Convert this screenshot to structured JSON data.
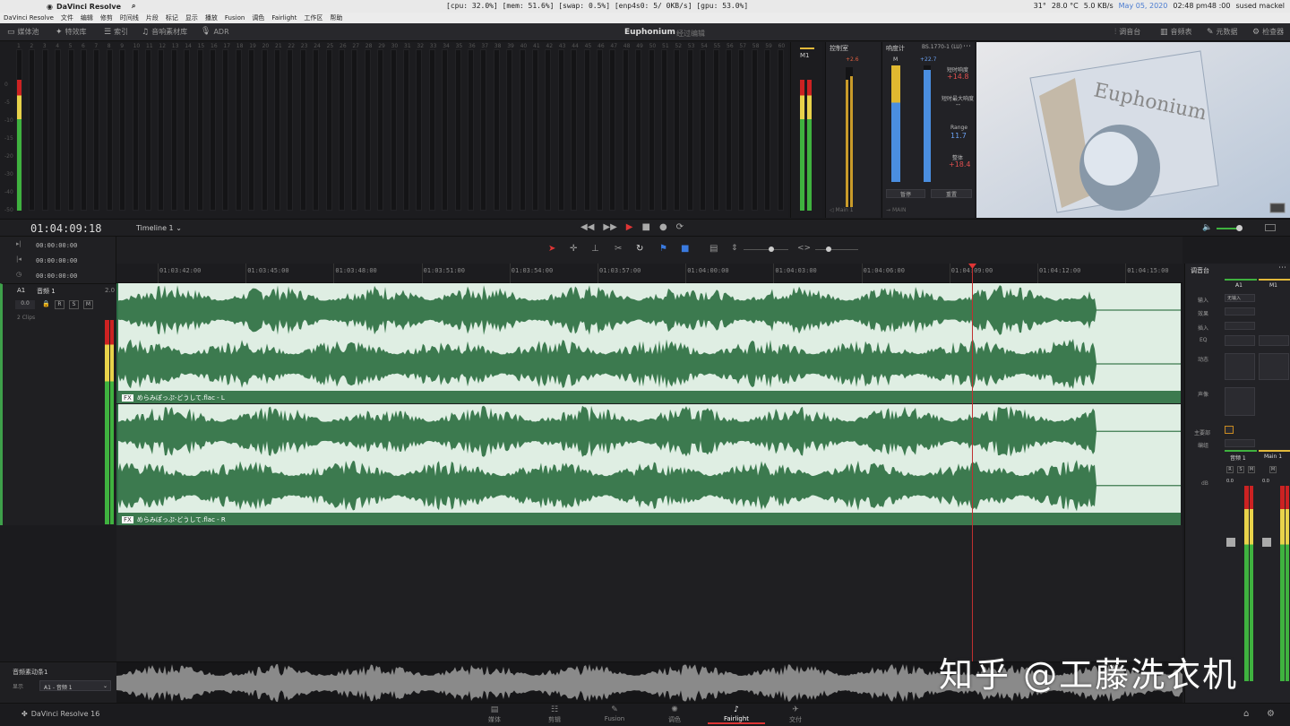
{
  "system_bar": {
    "app_name": "DaVinci Resolve",
    "stats": "[cpu:  32.0%] [mem:  51.6%] [swap:   0.5%] [enp4s0:     5/   0KB/s] [gpu:  53.0%]",
    "temp1": "31°",
    "temp2": "28.0 °C",
    "net": "5.0 KB/s",
    "date": "May 05, 2020",
    "time": "02:48 pm48 :00",
    "host": "sused mackel"
  },
  "menu": [
    "DaVinci Resolve",
    "文件",
    "编辑",
    "修剪",
    "时间线",
    "片段",
    "标记",
    "显示",
    "播放",
    "Fusion",
    "调色",
    "Fairlight",
    "工作区",
    "帮助"
  ],
  "toolbar": {
    "left": [
      {
        "label": "媒体池",
        "icon": "media-pool-icon"
      },
      {
        "label": "特效库",
        "icon": "effects-icon"
      },
      {
        "label": "索引",
        "icon": "index-icon"
      },
      {
        "label": "音响素材库",
        "icon": "sound-library-icon"
      },
      {
        "label": "ADR",
        "icon": "mic-icon"
      }
    ],
    "project_title": "Euphonium",
    "project_subtitle": "经过编辑",
    "right": [
      {
        "label": "调音台",
        "icon": "mixer-icon"
      },
      {
        "label": "音频表",
        "icon": "meters-icon"
      },
      {
        "label": "元数据",
        "icon": "metadata-icon"
      },
      {
        "label": "检查器",
        "icon": "inspector-icon"
      }
    ]
  },
  "meters": {
    "channel_numbers": [
      "1",
      "2",
      "3",
      "4",
      "5",
      "6",
      "7",
      "8",
      "9",
      "10",
      "11",
      "12",
      "13",
      "14",
      "15",
      "16",
      "17",
      "18",
      "19",
      "20",
      "21",
      "22",
      "23",
      "24",
      "25",
      "26",
      "27",
      "28",
      "29",
      "30",
      "31",
      "32",
      "33",
      "34",
      "35",
      "36",
      "37",
      "38",
      "39",
      "40",
      "41",
      "42",
      "43",
      "44",
      "45",
      "46",
      "47",
      "48",
      "49",
      "50",
      "51",
      "52",
      "53",
      "54",
      "55",
      "56",
      "57",
      "58",
      "59",
      "60"
    ],
    "scale": [
      "0",
      "-5",
      "-10",
      "-15",
      "-20",
      "-30",
      "-40",
      "-50"
    ],
    "master_label": "M1"
  },
  "control_room": {
    "title": "控制室",
    "peak": "+2.6",
    "source": "Main 1"
  },
  "loudness": {
    "title": "响度计",
    "standard": "BS.1770-1 (LU)",
    "m_label": "M",
    "m_value": "+22.7",
    "short_label": "短时响度",
    "short_value": "+14.8",
    "short_max_label": "短时最大响度",
    "short_max_value": "--",
    "range_label": "Range",
    "range_value": "11.7",
    "integrated_label": "整体",
    "integrated_value": "+18.4",
    "pause_btn": "暂停",
    "reset_btn": "重置",
    "out": "MAIN"
  },
  "timecode": {
    "current": "01:04:09:18",
    "timeline_name": "Timeline 1",
    "tc_rows": [
      "00:00:00:00",
      "00:00:00:00",
      "00:00:00:00"
    ]
  },
  "ruler_ticks": [
    "01:03:42:00",
    "01:03:45:00",
    "01:03:48:00",
    "01:03:51:00",
    "01:03:54:00",
    "01:03:57:00",
    "01:04:00:00",
    "01:04:03:00",
    "01:04:06:00",
    "01:04:09:00",
    "01:04:12:00",
    "01:04:15:00"
  ],
  "track": {
    "id": "A1",
    "name": "音频 1",
    "format": "2.0",
    "volume": "0.0",
    "r_btn": "R",
    "s_btn": "S",
    "m_btn": "M",
    "clips_count": "2 Clips"
  },
  "clips": [
    {
      "name": "めらみぽっぷ-どうして.flac - L",
      "badge": "FX"
    },
    {
      "name": "めらみぽっぷ-どうして.flac - R",
      "badge": "FX"
    }
  ],
  "mixer": {
    "title": "调音台",
    "ch1": "A1",
    "ch2": "M1",
    "rows": [
      "输入",
      "效果",
      "插入",
      "EQ",
      "动态",
      "声像",
      "主要部",
      "编组"
    ],
    "input_value": "无输入",
    "strip1": "音频 1",
    "strip2": "Main 1",
    "db_label": "dB",
    "vol1": "0.0",
    "vol2": "0.0",
    "r": "R",
    "s": "S",
    "m": "M",
    "m2": "M"
  },
  "overview": {
    "title": "音频素动条1",
    "show_label": "显示",
    "select": "A1 - 音频 1"
  },
  "pages": [
    {
      "label": "媒体",
      "icon": "media-page-icon"
    },
    {
      "label": "剪辑",
      "icon": "edit-page-icon"
    },
    {
      "label": "Fusion",
      "icon": "fusion-page-icon"
    },
    {
      "label": "调色",
      "icon": "color-page-icon"
    },
    {
      "label": "Fairlight",
      "icon": "fairlight-page-icon"
    },
    {
      "label": "交付",
      "icon": "deliver-page-icon"
    }
  ],
  "footer_app": "DaVinci Resolve 16",
  "watermark": "知乎 @工藤洗衣机",
  "colors": {
    "accent": "#c03030",
    "clip_bg": "#dfeee3",
    "wave": "#3c7a4f",
    "track_green": "#3ea04a"
  }
}
